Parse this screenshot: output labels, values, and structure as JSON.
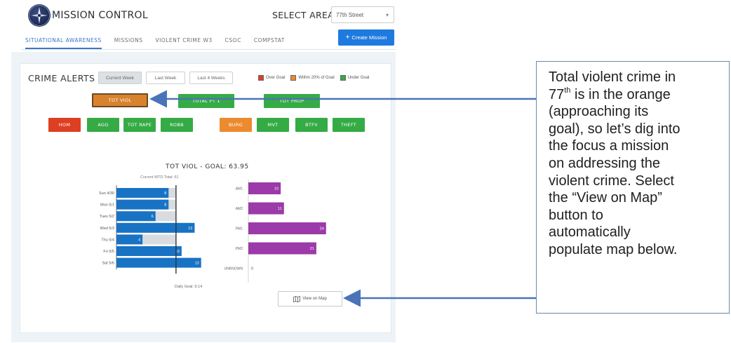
{
  "header": {
    "app_title": "MISSION CONTROL",
    "logo_icon": "globe-compass-icon",
    "select_area_label": "SELECT AREA",
    "selected_area": "77th Street"
  },
  "nav": {
    "tabs": [
      {
        "label": "SITUATIONAL AWARENESS",
        "active": true
      },
      {
        "label": "MISSIONS",
        "active": false
      },
      {
        "label": "VIOLENT CRIME W3",
        "active": false
      },
      {
        "label": "CSOC",
        "active": false
      },
      {
        "label": "COMPSTAT",
        "active": false
      }
    ],
    "create_mission_label": "Create Mission"
  },
  "crime_alerts": {
    "title": "CRIME ALERTS",
    "periods": [
      {
        "label": "Current Week",
        "active": true
      },
      {
        "label": "Last Week",
        "active": false
      },
      {
        "label": "Last 4 Weeks",
        "active": false
      }
    ],
    "legend": [
      {
        "label": "Over Goal",
        "color": "#dd3f22"
      },
      {
        "label": "Within 20% of Goal",
        "color": "#ec8a2e"
      },
      {
        "label": "Under Goal",
        "color": "#35ab45"
      }
    ],
    "summary_buttons": [
      {
        "label": "TOT VIOL",
        "status": "within",
        "selected": true
      },
      {
        "label": "TOTAL PT 1",
        "status": "under"
      },
      {
        "label": "TOT PROP",
        "status": "under"
      }
    ],
    "category_buttons": [
      {
        "label": "HOM",
        "status": "over"
      },
      {
        "label": "AGG",
        "status": "under"
      },
      {
        "label": "TOT RAPE",
        "status": "under"
      },
      {
        "label": "ROBB",
        "status": "under"
      },
      {
        "label": "BURG",
        "status": "within"
      },
      {
        "label": "MVT",
        "status": "under"
      },
      {
        "label": "BTFV",
        "status": "under"
      },
      {
        "label": "THEFT",
        "status": "under"
      }
    ]
  },
  "chart": {
    "title": "TOT VIOL - GOAL: 63.95",
    "subtitle": "Current WTD Total: 61",
    "daily_goal_label": "Daily Goal: 9.14",
    "view_map_label": "View on Map",
    "map_icon": "map-icon"
  },
  "chart_data": [
    {
      "type": "bar",
      "orientation": "horizontal",
      "categories": [
        "Sun 4/30",
        "Mon 5/1",
        "Tues 5/2",
        "Wed 5/3",
        "Thu 5/4",
        "Fri 5/5",
        "Sat 5/6"
      ],
      "values": [
        8,
        8,
        6,
        12,
        4,
        10,
        13
      ],
      "goal_line": 9.14,
      "xlim": [
        0,
        14
      ],
      "color": "#1873c4",
      "goal_fill_color": "#d9dcdf"
    },
    {
      "type": "bar",
      "orientation": "horizontal",
      "categories": [
        "AM1",
        "AM2",
        "PM1",
        "PM2",
        "UNKNOWN"
      ],
      "values": [
        10,
        11,
        24,
        21,
        0
      ],
      "xlim": [
        0,
        26
      ],
      "color": "#9b3aa8"
    }
  ],
  "annotation": {
    "line1": "Total violent crime in",
    "line2_num": "77",
    "line2_sup": "th",
    "line2_rest": " is in the orange",
    "lines": [
      "(approaching its",
      "goal), so let’s dig into",
      "the focus a mission",
      "on addressing the",
      "violent crime. Select",
      "the “View on Map”",
      "button to",
      "automatically",
      "populate map below."
    ]
  }
}
